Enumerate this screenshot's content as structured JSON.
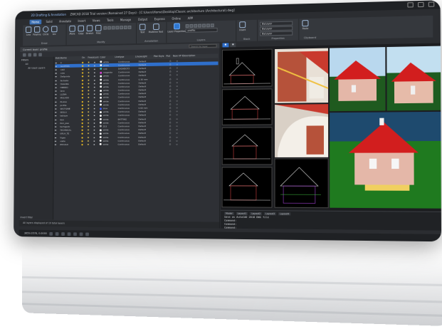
{
  "titlebar": {
    "workspace": "2D Drafting & Annotation",
    "title": "ZWCAD 2018 Trial version (Remained 27 Days) - [C:\\Users\\Home\\Desktop\\Classic architecture (Architectural).dwg]"
  },
  "ribbon": {
    "tabs": [
      "Home",
      "Solid",
      "Annotate",
      "Insert",
      "Views",
      "Tools",
      "Manage",
      "Output",
      "Express",
      "Online",
      "APP"
    ],
    "groups": [
      {
        "title": "Draw",
        "buttons": [
          "Line",
          "Polyline",
          "Circle",
          "Arc"
        ]
      },
      {
        "title": "Modify",
        "buttons": [
          "Move",
          "Copy",
          "Stretch",
          "Fillet"
        ]
      },
      {
        "title": "Annotation",
        "buttons": [
          "Text",
          "Multiline Text"
        ]
      },
      {
        "title": "Layers",
        "buttons": [
          "Layer Properties"
        ],
        "combo": "profile"
      },
      {
        "title": "Block",
        "buttons": [
          "Insert"
        ]
      },
      {
        "title": "Properties",
        "combos": [
          "ByLayer",
          "ByLayer",
          "ByLayer"
        ]
      },
      {
        "title": "Clipboard",
        "buttons": [
          "Paste"
        ]
      }
    ]
  },
  "layer_manager": {
    "title": "Current layer: profile",
    "search_placeholder": "Search for layer",
    "filters_label": "Filters",
    "filter_all": "All",
    "filter_used": "All Used Layers",
    "invert_filter": "Invert filter",
    "status_text": "All layers displayed of 19 total layers",
    "columns": [
      "Status",
      "Name",
      "On",
      "Freeze",
      "Lock",
      "Color",
      "Linetype",
      "Lineweight",
      "Plot Style",
      "Plot",
      "New VP Freeze",
      "Description"
    ],
    "rows": [
      {
        "name": "0",
        "color": "white",
        "linetype": "Continuous",
        "lineweight": "Default",
        "color_hex": "#ffffff"
      },
      {
        "name": "ALDFENS",
        "color": "white",
        "linetype": "Continuous",
        "lineweight": "Default",
        "color_hex": "#ffffff",
        "selected": true
      },
      {
        "name": "cat2",
        "color": "130",
        "linetype": "DASHDOT2",
        "lineweight": "Default",
        "color_hex": "#40c0c0"
      },
      {
        "name": "cota",
        "color": "magenta",
        "linetype": "Continuous",
        "lineweight": "Default",
        "color_hex": "#e040e0"
      },
      {
        "name": "Defpoints",
        "color": "white",
        "linetype": "Continuous",
        "lineweight": "Default",
        "color_hex": "#ffffff"
      },
      {
        "name": "fachada",
        "color": "white",
        "linetype": "Continuous",
        "lineweight": "0.30 mm",
        "color_hex": "#ffffff"
      },
      {
        "name": "HAGURA",
        "color": "white",
        "linetype": "Continuous",
        "lineweight": "Default",
        "color_hex": "#ffffff"
      },
      {
        "name": "HIERRO",
        "color": "white",
        "linetype": "Continuous",
        "lineweight": "Default",
        "color_hex": "#ffffff"
      },
      {
        "name": "lana",
        "color": "white",
        "linetype": "Continuous",
        "lineweight": "Default",
        "color_hex": "#ffffff"
      },
      {
        "name": "LLENA",
        "color": "white",
        "linetype": "Continuous",
        "lineweight": "Default",
        "color_hex": "#ffffff"
      },
      {
        "name": "MULADO",
        "color": "white",
        "linetype": "Continuous",
        "lineweight": "Default",
        "color_hex": "#ffffff"
      },
      {
        "name": "PLAGA",
        "color": "white",
        "linetype": "Continuous",
        "lineweight": "Default",
        "color_hex": "#ffffff"
      },
      {
        "name": "profile",
        "color": "white",
        "linetype": "Continuous",
        "lineweight": "Default",
        "color_hex": "#ffffff"
      },
      {
        "name": "SECTIONE",
        "color": "blue",
        "linetype": "Continuous",
        "lineweight": "0.60 mm",
        "color_hex": "#4060ff"
      },
      {
        "name": "SEOLA",
        "color": "white",
        "linetype": "Continuous",
        "lineweight": "Default",
        "color_hex": "#ffffff"
      },
      {
        "name": "tabique",
        "color": "white",
        "linetype": "Continuous",
        "lineweight": "Default",
        "color_hex": "#ffffff"
      },
      {
        "name": "tbm",
        "color": "white",
        "linetype": "BATTING",
        "lineweight": "Default",
        "color_hex": "#ffffff"
      },
      {
        "name": "tbm_piso",
        "color": "white",
        "linetype": "Continuous",
        "lineweight": "Default",
        "color_hex": "#ffffff"
      },
      {
        "name": "techigado",
        "color": "253",
        "linetype": "Continuous",
        "lineweight": "Default",
        "color_hex": "#b0b0b0"
      },
      {
        "name": "TECHNICAL",
        "color": "white",
        "linetype": "Continuous",
        "lineweight": "Default",
        "color_hex": "#ffffff"
      },
      {
        "name": "URUA_TE",
        "color": "white",
        "linetype": "Continuous",
        "lineweight": "Default",
        "color_hex": "#ffffff"
      },
      {
        "name": "Vigas",
        "color": "white",
        "linetype": "Continuous",
        "lineweight": "Default",
        "color_hex": "#ffffff"
      },
      {
        "name": "vialla",
        "color": "white",
        "linetype": "Continuous",
        "lineweight": "Default",
        "color_hex": "#ffffff"
      },
      {
        "name": "ZOCALO",
        "color": "white",
        "linetype": "Continuous",
        "lineweight": "Default",
        "color_hex": "#ffffff"
      }
    ]
  },
  "viewport": {
    "tabs": [
      "Model",
      "Layout1",
      "Layout2",
      "Layout3",
      "Layout4"
    ],
    "command_lines": [
      "Save as AutoCAD 2018 DWG file",
      "Command:",
      "Command:",
      "Command:"
    ]
  },
  "statusbar": {
    "coords": "3659.0578, 0.0000"
  }
}
